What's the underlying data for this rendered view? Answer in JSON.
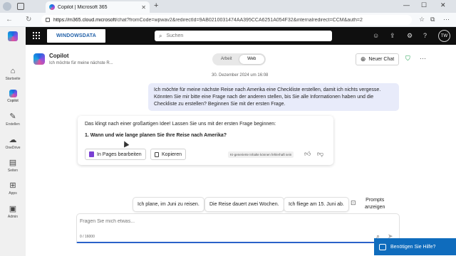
{
  "browser": {
    "tab_title": "Copilot | Microsoft 365",
    "tab_close": "✕",
    "new_tab": "+",
    "url_host": "https://m365.cloud.microsoft",
    "url_path": "/chat?fromCode=wpwav2&redirectId=9AB0210031474AA395CCA6251A054F32&internalredirect=CCM&auth=2",
    "minimize": "—",
    "maximize": "☐",
    "close": "✕"
  },
  "topbar": {
    "brand_text": "WINDOWSDATA",
    "search_placeholder": "Suchen",
    "avatar_initials": "TW"
  },
  "rail": {
    "items": [
      {
        "label": "Startseite",
        "icon": "home-icon"
      },
      {
        "label": "Copilot",
        "icon": "copilot-icon"
      },
      {
        "label": "Erstellen",
        "icon": "pen-icon"
      },
      {
        "label": "OneDrive",
        "icon": "cloud-icon"
      },
      {
        "label": "Seiten",
        "icon": "pages-icon"
      },
      {
        "label": "Apps",
        "icon": "apps-icon"
      },
      {
        "label": "Admin",
        "icon": "admin-icon"
      }
    ]
  },
  "header": {
    "title": "Copilot",
    "subtitle": "Ich möchte für meine nächste R...",
    "toggle": {
      "work": "Arbeit",
      "web": "Web",
      "selected": "Web"
    },
    "new_chat": "Neuer Chat"
  },
  "chat": {
    "date": "30. Dezember 2024 um 16:08",
    "user_message": "Ich möchte für meine nächste Reise nach Amerika eine Checkliste erstellen, damit ich nichts vergesse. Könnten Sie mir bitte eine Frage nach der anderen stellen, bis Sie alle Informationen haben und die Checkliste zu erstellen? Beginnen Sie mit der ersten Frage.",
    "ai_intro": "Das klingt nach einer großartigen Idee! Lassen Sie uns mit der ersten Frage beginnen:",
    "ai_question": "1. Wann und wie lange planen Sie Ihre Reise nach Amerika?",
    "btn_pages": "In Pages bearbeiten",
    "btn_copy": "Kopieren",
    "disclaimer": "KI-generierte Inhalte können fehlerhaft sein"
  },
  "suggestions": [
    "Ich plane, im Juni zu reisen.",
    "Die Reise dauert zwei Wochen.",
    "Ich fliege am 15. Juni ab."
  ],
  "prompts_label_1": "Prompts",
  "prompts_label_2": "anzeigen",
  "composer": {
    "placeholder": "Fragen Sie mich etwas...",
    "counter": "0 / 16000"
  },
  "help_button": "Benötigen Sie Hilfe?",
  "colors": {
    "accent": "#0f6cbd",
    "user_bubble": "#e8ebfa",
    "topbar": "#0f0f0f"
  }
}
